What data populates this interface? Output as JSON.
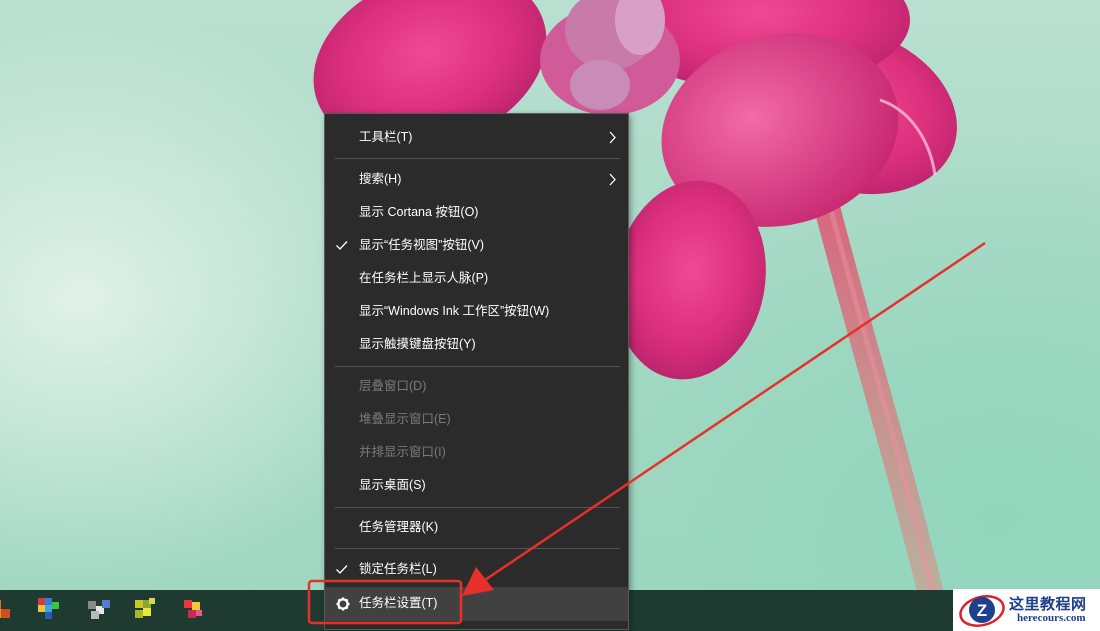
{
  "context_menu": {
    "items": [
      {
        "label": "工具栏(T)",
        "submenu": true
      },
      {
        "label": "搜索(H)",
        "submenu": true
      },
      {
        "label": "显示 Cortana 按钮(O)"
      },
      {
        "label": "显示“任务视图”按钮(V)",
        "checked": true
      },
      {
        "label": "在任务栏上显示人脉(P)"
      },
      {
        "label": "显示“Windows Ink 工作区”按钮(W)"
      },
      {
        "label": "显示触摸键盘按钮(Y)"
      },
      {
        "label": "层叠窗口(D)",
        "disabled": true
      },
      {
        "label": "堆叠显示窗口(E)",
        "disabled": true
      },
      {
        "label": "并排显示窗口(I)",
        "disabled": true
      },
      {
        "label": "显示桌面(S)"
      },
      {
        "label": "任务管理器(K)"
      },
      {
        "label": "锁定任务栏(L)",
        "checked": true
      },
      {
        "label": "任务栏设置(T)",
        "icon": "gear-icon",
        "highlighted": true
      }
    ]
  },
  "taskbar": {
    "icons": [
      "pinned-app-icon",
      "pinned-app-icon",
      "pinned-app-icon",
      "pinned-app-icon",
      "pinned-app-icon"
    ]
  },
  "annotation": {
    "color": "#e8302a"
  },
  "watermark": {
    "title": "这里教程网",
    "domain": "herecours.com",
    "logo_letter": "Z"
  },
  "colors": {
    "menu_bg": "#2b2b2b",
    "menu_hover": "#414141",
    "menu_text": "#ffffff",
    "menu_disabled_text": "#7a7a7a",
    "flower": "#e0377f"
  }
}
